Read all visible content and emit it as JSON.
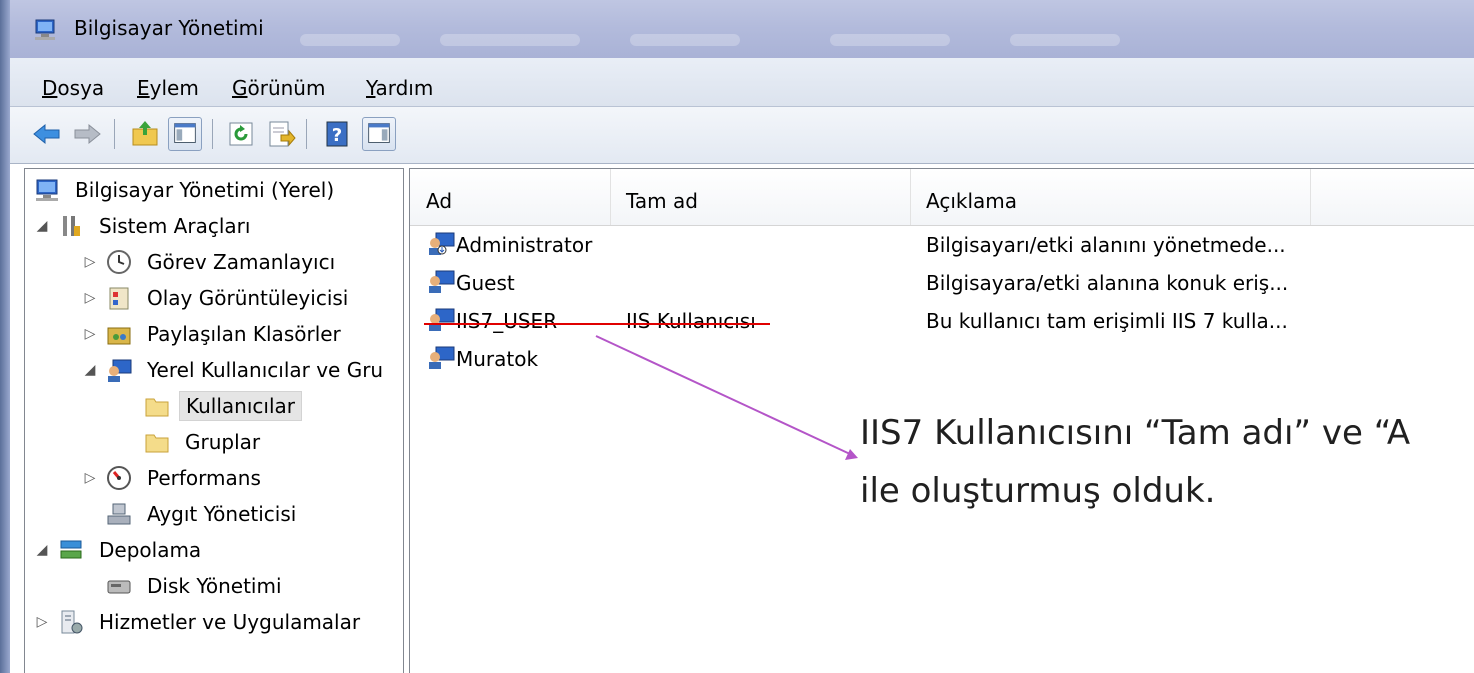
{
  "window": {
    "title": "Bilgisayar Yönetimi"
  },
  "menu": [
    {
      "key": "D",
      "rest": "osya"
    },
    {
      "key": "E",
      "rest": "ylem"
    },
    {
      "key": "G",
      "rest": "örünüm"
    },
    {
      "key": "Y",
      "rest": "ardım"
    }
  ],
  "toolbar": {
    "buttons": [
      "back-icon",
      "forward-icon",
      "up-folder-icon",
      "show-hide-tree-icon",
      "refresh-icon",
      "export-list-icon",
      "help-icon",
      "action-pane-icon"
    ]
  },
  "tree": {
    "items": [
      {
        "label": "Bilgisayar Yönetimi (Yerel)",
        "icon": "computer-management-icon"
      },
      {
        "label": "Sistem Araçları",
        "icon": "tools-icon"
      },
      {
        "label": "Görev Zamanlayıcı",
        "icon": "clock-icon"
      },
      {
        "label": "Olay Görüntüleyicisi",
        "icon": "event-viewer-icon"
      },
      {
        "label": "Paylaşılan Klasörler",
        "icon": "shared-folder-icon"
      },
      {
        "label": "Yerel Kullanıcılar ve Gru",
        "icon": "users-groups-icon"
      },
      {
        "label": "Kullanıcılar",
        "icon": "folder-icon"
      },
      {
        "label": "Gruplar",
        "icon": "folder-icon"
      },
      {
        "label": "Performans",
        "icon": "performance-icon"
      },
      {
        "label": "Aygıt Yöneticisi",
        "icon": "device-manager-icon"
      },
      {
        "label": "Depolama",
        "icon": "storage-icon"
      },
      {
        "label": "Disk Yönetimi",
        "icon": "disk-icon"
      },
      {
        "label": "Hizmetler ve Uygulamalar",
        "icon": "services-icon"
      }
    ]
  },
  "list": {
    "columns": [
      "Ad",
      "Tam ad",
      "Açıklama"
    ],
    "rows": [
      {
        "name": "Administrator",
        "fullname": "",
        "description": "Bilgisayarı/etki alanını yönetmede..."
      },
      {
        "name": "Guest",
        "fullname": "",
        "description": "Bilgisayara/etki alanına konuk eriş..."
      },
      {
        "name": "IIS7_USER",
        "fullname": "IIS Kullanıcısı",
        "description": "Bu kullanıcı tam erişimli IIS 7 kulla..."
      },
      {
        "name": "Muratok",
        "fullname": "",
        "description": ""
      }
    ]
  },
  "annotation": {
    "line1": "IIS7 Kullanıcısını “Tam adı” ve “A",
    "line2": "ile oluşturmuş olduk.",
    "underline_color": "#e00000",
    "arrow_color": "#b455c8"
  }
}
